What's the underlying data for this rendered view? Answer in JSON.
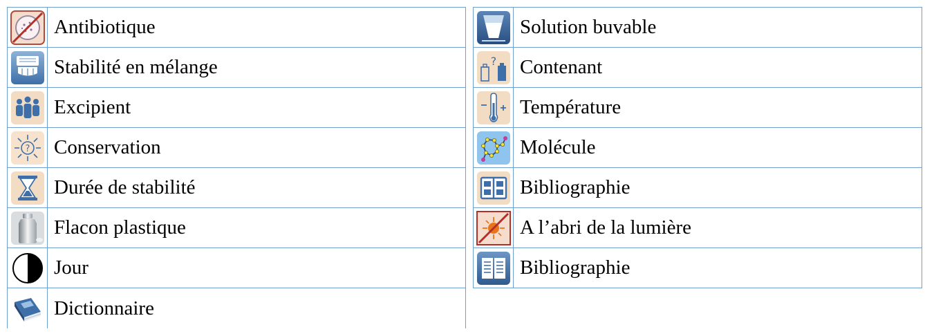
{
  "left_items": [
    {
      "icon": "antibiotic-icon",
      "label": "Antibiotique"
    },
    {
      "icon": "mixing-stability-icon",
      "label": "Stabilité en mélange"
    },
    {
      "icon": "excipient-people-icon",
      "label": "Excipient"
    },
    {
      "icon": "conservation-sun-icon",
      "label": "Conservation"
    },
    {
      "icon": "hourglass-icon",
      "label": "Durée de stabilité"
    },
    {
      "icon": "plastic-bottle-icon",
      "label": "Flacon plastique"
    },
    {
      "icon": "half-circle-icon",
      "label": "Jour"
    },
    {
      "icon": "dictionary-book-icon",
      "label": "Dictionnaire"
    }
  ],
  "right_items": [
    {
      "icon": "drinking-glass-icon",
      "label": "Solution buvable"
    },
    {
      "icon": "container-question-icon",
      "label": "Contenant"
    },
    {
      "icon": "thermometer-icon",
      "label": "Température"
    },
    {
      "icon": "molecule-icon",
      "label": "Molécule"
    },
    {
      "icon": "bibliography-book-icon",
      "label": "Bibliographie"
    },
    {
      "icon": "no-light-icon",
      "label": "A l’abri de la lumière"
    },
    {
      "icon": "bibliography-open-book-icon",
      "label": "Bibliographie"
    }
  ],
  "colors": {
    "border": "#6f9fd0",
    "icon_blue": "#3f6fa8",
    "icon_peach": "#f3dcc4",
    "no_light_red": "#b0302a",
    "sun_orange": "#e8751a"
  }
}
